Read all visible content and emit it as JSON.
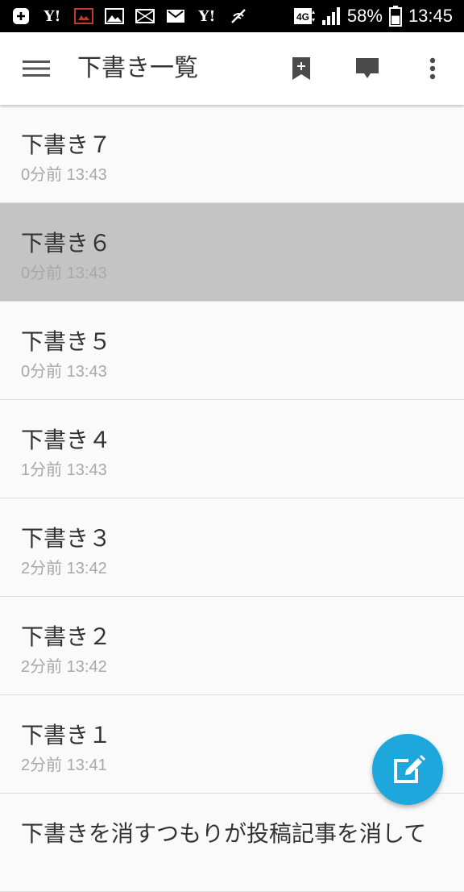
{
  "status_bar": {
    "left_icons": [
      "add-box-icon",
      "yahoo-icon",
      "photo-gallery-icon",
      "image-icon",
      "mail-icon",
      "gmail-icon",
      "yahoo-icon",
      "no-wifi-icon"
    ],
    "network": "4G",
    "battery": "58%",
    "battery_level": 0.58,
    "time": "13:45"
  },
  "app_bar": {
    "title": "下書き一覧",
    "actions": [
      "add-bookmark-icon",
      "comment-icon",
      "more-vert-icon"
    ]
  },
  "drafts": [
    {
      "title": "下書き７",
      "meta": "0分前 13:43",
      "selected": false
    },
    {
      "title": "下書き６",
      "meta": "0分前 13:43",
      "selected": true
    },
    {
      "title": "下書き５",
      "meta": "0分前 13:43",
      "selected": false
    },
    {
      "title": "下書き４",
      "meta": "1分前 13:43",
      "selected": false
    },
    {
      "title": "下書き３",
      "meta": "2分前 13:42",
      "selected": false
    },
    {
      "title": "下書き２",
      "meta": "2分前 13:42",
      "selected": false
    },
    {
      "title": "下書き１",
      "meta": "2分前 13:41",
      "selected": false
    },
    {
      "title": "下書きを消すつもりが投稿記事を消して",
      "meta": "",
      "selected": false
    }
  ],
  "fab": {
    "icon": "edit-icon"
  },
  "colors": {
    "status_bar": "#000000",
    "app_bar": "#ffffff",
    "list_background": "#fafafa",
    "selected_row": "#c4c4c4",
    "fab": "#1ea7dd",
    "title_text": "#333333",
    "meta_text": "#a8a8a8"
  }
}
